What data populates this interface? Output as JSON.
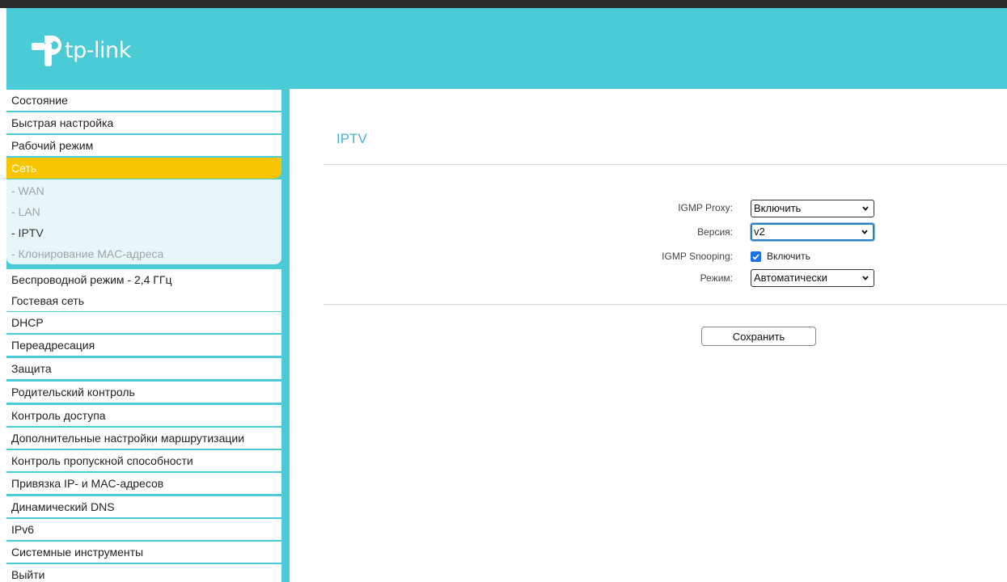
{
  "brand": {
    "name": "tp-link",
    "colors": {
      "header": "#4acbd6",
      "active_menu": "#f7c600",
      "submenu_bg": "#e7f6f9",
      "title": "#4ab2d6"
    }
  },
  "sidebar": {
    "items_top": [
      {
        "label": "Состояние"
      },
      {
        "label": "Быстрая настройка"
      },
      {
        "label": "Рабочий режим"
      }
    ],
    "active_item": {
      "label": "Сеть"
    },
    "subitems": [
      {
        "label": "- WAN"
      },
      {
        "label": "- LAN"
      },
      {
        "label": "- IPTV",
        "current": true
      },
      {
        "label": "- Клонирование MAC-адреса"
      }
    ],
    "items_bottom": [
      {
        "label": "Беспроводной режим - 2,4 ГГц"
      },
      {
        "label": "Гостевая сеть"
      },
      {
        "label": "DHCP"
      },
      {
        "label": "Переадресация"
      },
      {
        "label": "Защита"
      },
      {
        "label": "Родительский контроль"
      },
      {
        "label": "Контроль доступа"
      },
      {
        "label": "Дополнительные настройки маршрутизации"
      },
      {
        "label": "Контроль пропускной способности"
      },
      {
        "label": "Привязка IP- и MAC-адресов"
      },
      {
        "label": "Динамический DNS"
      },
      {
        "label": "IPv6"
      },
      {
        "label": "Системные инструменты"
      },
      {
        "label": "Выйти"
      }
    ]
  },
  "main": {
    "title": "IPTV",
    "form": {
      "igmp_proxy": {
        "label": "IGMP Proxy:",
        "value": "Включить"
      },
      "version": {
        "label": "Версия:",
        "value": "v2"
      },
      "igmp_snooping": {
        "label": "IGMP Snooping:",
        "checked": true,
        "checkbox_label": "Включить"
      },
      "mode": {
        "label": "Режим:",
        "value": "Автоматически"
      }
    },
    "save_label": "Сохранить"
  }
}
